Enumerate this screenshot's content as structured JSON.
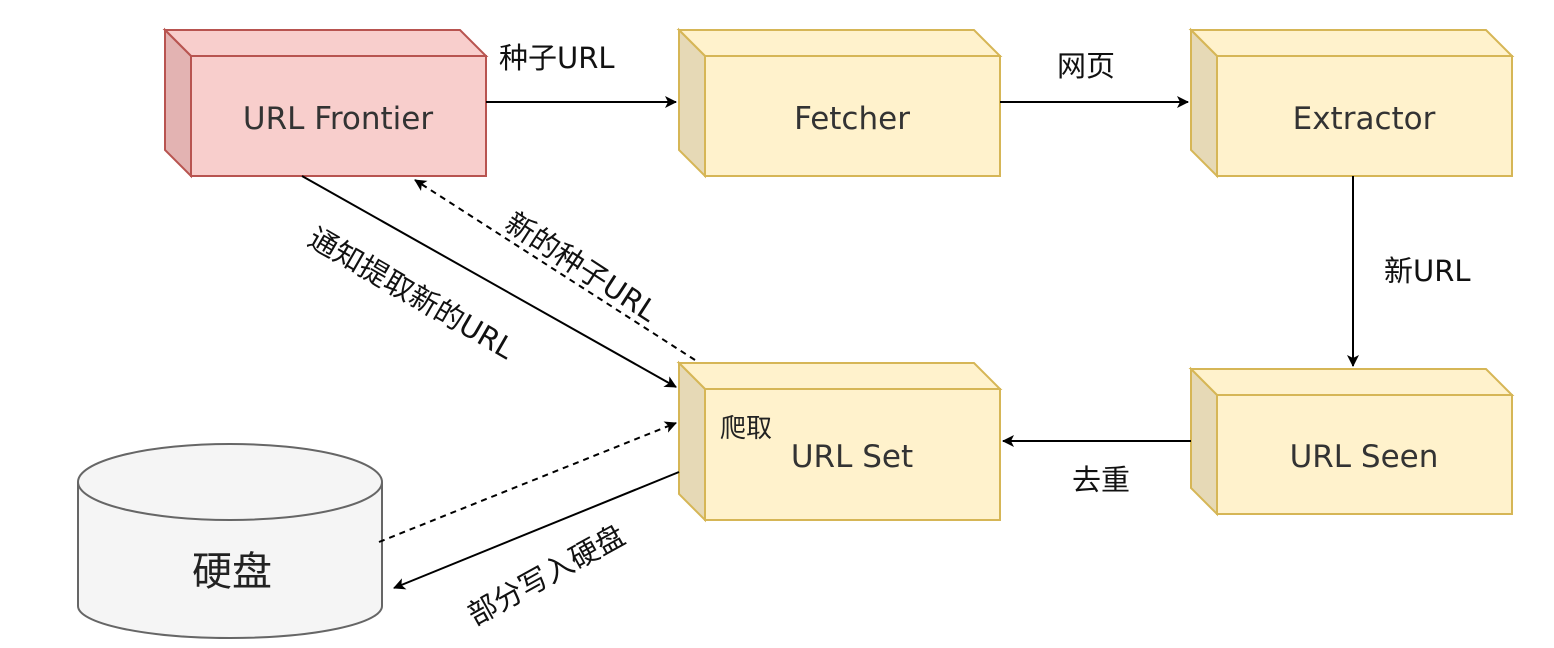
{
  "diagram": {
    "nodes": {
      "frontier": {
        "label": "URL Frontier",
        "fill": "#f8cecc",
        "stroke": "#b85450"
      },
      "fetcher": {
        "label": "Fetcher",
        "fill": "#fff2cc",
        "stroke": "#d6b656"
      },
      "extractor": {
        "label": "Extractor",
        "fill": "#fff2cc",
        "stroke": "#d6b656"
      },
      "urlset": {
        "label": "URL Set",
        "fill": "#fff2cc",
        "stroke": "#d6b656"
      },
      "urlseen": {
        "label": "URL Seen",
        "fill": "#fff2cc",
        "stroke": "#d6b656"
      },
      "disk": {
        "label": "硬盘",
        "fill": "#f5f5f5",
        "stroke": "#666666"
      }
    },
    "edges": {
      "frontier_to_fetcher": "种子URL",
      "fetcher_to_extractor": "网页",
      "extractor_to_urlseen": "新URL",
      "urlseen_to_urlset": "去重",
      "frontier_to_urlset": "通知提取新的URL",
      "urlset_to_frontier": "新的种子URL",
      "urlset_to_disk": "部分写入硬盘",
      "disk_to_urlset": "爬取"
    }
  }
}
